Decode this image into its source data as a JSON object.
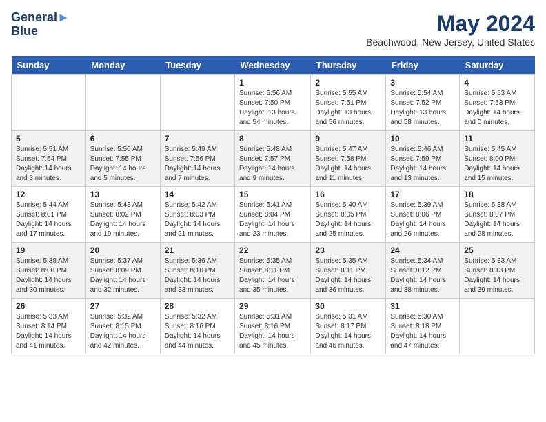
{
  "header": {
    "logo_line1": "General",
    "logo_line2": "Blue",
    "month_year": "May 2024",
    "location": "Beachwood, New Jersey, United States"
  },
  "days_of_week": [
    "Sunday",
    "Monday",
    "Tuesday",
    "Wednesday",
    "Thursday",
    "Friday",
    "Saturday"
  ],
  "weeks": [
    [
      {
        "day": "",
        "sunrise": "",
        "sunset": "",
        "daylight": ""
      },
      {
        "day": "",
        "sunrise": "",
        "sunset": "",
        "daylight": ""
      },
      {
        "day": "",
        "sunrise": "",
        "sunset": "",
        "daylight": ""
      },
      {
        "day": "1",
        "sunrise": "Sunrise: 5:56 AM",
        "sunset": "Sunset: 7:50 PM",
        "daylight": "Daylight: 13 hours and 54 minutes."
      },
      {
        "day": "2",
        "sunrise": "Sunrise: 5:55 AM",
        "sunset": "Sunset: 7:51 PM",
        "daylight": "Daylight: 13 hours and 56 minutes."
      },
      {
        "day": "3",
        "sunrise": "Sunrise: 5:54 AM",
        "sunset": "Sunset: 7:52 PM",
        "daylight": "Daylight: 13 hours and 58 minutes."
      },
      {
        "day": "4",
        "sunrise": "Sunrise: 5:53 AM",
        "sunset": "Sunset: 7:53 PM",
        "daylight": "Daylight: 14 hours and 0 minutes."
      }
    ],
    [
      {
        "day": "5",
        "sunrise": "Sunrise: 5:51 AM",
        "sunset": "Sunset: 7:54 PM",
        "daylight": "Daylight: 14 hours and 3 minutes."
      },
      {
        "day": "6",
        "sunrise": "Sunrise: 5:50 AM",
        "sunset": "Sunset: 7:55 PM",
        "daylight": "Daylight: 14 hours and 5 minutes."
      },
      {
        "day": "7",
        "sunrise": "Sunrise: 5:49 AM",
        "sunset": "Sunset: 7:56 PM",
        "daylight": "Daylight: 14 hours and 7 minutes."
      },
      {
        "day": "8",
        "sunrise": "Sunrise: 5:48 AM",
        "sunset": "Sunset: 7:57 PM",
        "daylight": "Daylight: 14 hours and 9 minutes."
      },
      {
        "day": "9",
        "sunrise": "Sunrise: 5:47 AM",
        "sunset": "Sunset: 7:58 PM",
        "daylight": "Daylight: 14 hours and 11 minutes."
      },
      {
        "day": "10",
        "sunrise": "Sunrise: 5:46 AM",
        "sunset": "Sunset: 7:59 PM",
        "daylight": "Daylight: 14 hours and 13 minutes."
      },
      {
        "day": "11",
        "sunrise": "Sunrise: 5:45 AM",
        "sunset": "Sunset: 8:00 PM",
        "daylight": "Daylight: 14 hours and 15 minutes."
      }
    ],
    [
      {
        "day": "12",
        "sunrise": "Sunrise: 5:44 AM",
        "sunset": "Sunset: 8:01 PM",
        "daylight": "Daylight: 14 hours and 17 minutes."
      },
      {
        "day": "13",
        "sunrise": "Sunrise: 5:43 AM",
        "sunset": "Sunset: 8:02 PM",
        "daylight": "Daylight: 14 hours and 19 minutes."
      },
      {
        "day": "14",
        "sunrise": "Sunrise: 5:42 AM",
        "sunset": "Sunset: 8:03 PM",
        "daylight": "Daylight: 14 hours and 21 minutes."
      },
      {
        "day": "15",
        "sunrise": "Sunrise: 5:41 AM",
        "sunset": "Sunset: 8:04 PM",
        "daylight": "Daylight: 14 hours and 23 minutes."
      },
      {
        "day": "16",
        "sunrise": "Sunrise: 5:40 AM",
        "sunset": "Sunset: 8:05 PM",
        "daylight": "Daylight: 14 hours and 25 minutes."
      },
      {
        "day": "17",
        "sunrise": "Sunrise: 5:39 AM",
        "sunset": "Sunset: 8:06 PM",
        "daylight": "Daylight: 14 hours and 26 minutes."
      },
      {
        "day": "18",
        "sunrise": "Sunrise: 5:38 AM",
        "sunset": "Sunset: 8:07 PM",
        "daylight": "Daylight: 14 hours and 28 minutes."
      }
    ],
    [
      {
        "day": "19",
        "sunrise": "Sunrise: 5:38 AM",
        "sunset": "Sunset: 8:08 PM",
        "daylight": "Daylight: 14 hours and 30 minutes."
      },
      {
        "day": "20",
        "sunrise": "Sunrise: 5:37 AM",
        "sunset": "Sunset: 8:09 PM",
        "daylight": "Daylight: 14 hours and 32 minutes."
      },
      {
        "day": "21",
        "sunrise": "Sunrise: 5:36 AM",
        "sunset": "Sunset: 8:10 PM",
        "daylight": "Daylight: 14 hours and 33 minutes."
      },
      {
        "day": "22",
        "sunrise": "Sunrise: 5:35 AM",
        "sunset": "Sunset: 8:11 PM",
        "daylight": "Daylight: 14 hours and 35 minutes."
      },
      {
        "day": "23",
        "sunrise": "Sunrise: 5:35 AM",
        "sunset": "Sunset: 8:11 PM",
        "daylight": "Daylight: 14 hours and 36 minutes."
      },
      {
        "day": "24",
        "sunrise": "Sunrise: 5:34 AM",
        "sunset": "Sunset: 8:12 PM",
        "daylight": "Daylight: 14 hours and 38 minutes."
      },
      {
        "day": "25",
        "sunrise": "Sunrise: 5:33 AM",
        "sunset": "Sunset: 8:13 PM",
        "daylight": "Daylight: 14 hours and 39 minutes."
      }
    ],
    [
      {
        "day": "26",
        "sunrise": "Sunrise: 5:33 AM",
        "sunset": "Sunset: 8:14 PM",
        "daylight": "Daylight: 14 hours and 41 minutes."
      },
      {
        "day": "27",
        "sunrise": "Sunrise: 5:32 AM",
        "sunset": "Sunset: 8:15 PM",
        "daylight": "Daylight: 14 hours and 42 minutes."
      },
      {
        "day": "28",
        "sunrise": "Sunrise: 5:32 AM",
        "sunset": "Sunset: 8:16 PM",
        "daylight": "Daylight: 14 hours and 44 minutes."
      },
      {
        "day": "29",
        "sunrise": "Sunrise: 5:31 AM",
        "sunset": "Sunset: 8:16 PM",
        "daylight": "Daylight: 14 hours and 45 minutes."
      },
      {
        "day": "30",
        "sunrise": "Sunrise: 5:31 AM",
        "sunset": "Sunset: 8:17 PM",
        "daylight": "Daylight: 14 hours and 46 minutes."
      },
      {
        "day": "31",
        "sunrise": "Sunrise: 5:30 AM",
        "sunset": "Sunset: 8:18 PM",
        "daylight": "Daylight: 14 hours and 47 minutes."
      },
      {
        "day": "",
        "sunrise": "",
        "sunset": "",
        "daylight": ""
      }
    ]
  ]
}
